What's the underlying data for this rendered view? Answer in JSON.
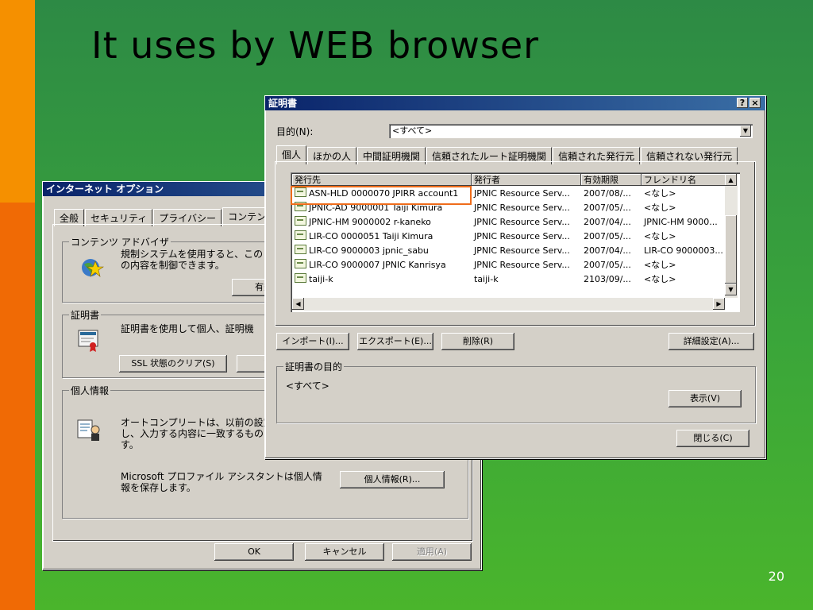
{
  "slide": {
    "title": "It uses by WEB browser",
    "page_number": "20"
  },
  "internet_options": {
    "title": "インターネット オプション",
    "tabs": [
      "全般",
      "セキュリティ",
      "プライバシー",
      "コンテンツ"
    ],
    "content_advisor": {
      "label": "コンテンツ アドバイザ",
      "text1": "規制システムを使用すると、このコ",
      "text2": "の内容を制御できます。",
      "button": "有効"
    },
    "certificates": {
      "label": "証明書",
      "text": "証明書を使用して個人、証明機",
      "ssl_button": "SSL 状態のクリア(S)",
      "cert_button": "証"
    },
    "personal_info": {
      "label": "個人情報",
      "text1": "オートコンプリートは、以前の設定",
      "text2": "し、入力する内容に一致するもの",
      "text3": "す。",
      "ms_text1": "Microsoft プロファイル アシスタントは個人情",
      "ms_text2": "報を保存します。",
      "personal_button": "個人情報(R)..."
    },
    "buttons": {
      "ok": "OK",
      "cancel": "キャンセル",
      "apply": "適用(A)"
    }
  },
  "cert_dialog": {
    "title": "証明書",
    "help_btn": "?",
    "close_btn": "×",
    "purpose_label": "目的(N):",
    "purpose_value": "<すべて>",
    "tabs": [
      "個人",
      "ほかの人",
      "中間証明機関",
      "信頼されたルート証明機関",
      "信頼された発行元",
      "信頼されない発行元"
    ],
    "columns": [
      "発行先",
      "発行者",
      "有効期限",
      "フレンドリ名"
    ],
    "rows": [
      [
        "ASN-HLD 0000070 JPIRR account1",
        "JPNIC Resource Serv...",
        "2007/08/...",
        "<なし>"
      ],
      [
        "JPNIC-AD 9000001 Taiji Kimura",
        "JPNIC Resource Serv...",
        "2007/05/...",
        "<なし>"
      ],
      [
        "JPNIC-HM 9000002 r-kaneko",
        "JPNIC Resource Serv...",
        "2007/04/...",
        "JPNIC-HM 9000..."
      ],
      [
        "LIR-CO 0000051 Taiji Kimura",
        "JPNIC Resource Serv...",
        "2007/05/...",
        "<なし>"
      ],
      [
        "LIR-CO 9000003 jpnic_sabu",
        "JPNIC Resource Serv...",
        "2007/04/...",
        "LIR-CO 9000003..."
      ],
      [
        "LIR-CO 9000007 JPNIC Kanrisya",
        "JPNIC Resource Serv...",
        "2007/05/...",
        "<なし>"
      ],
      [
        "taiji-k",
        "taiji-k",
        "2103/09/...",
        "<なし>"
      ]
    ],
    "buttons": {
      "import": "インポート(I)...",
      "export": "エクスポート(E)...",
      "remove": "削除(R)",
      "advanced": "詳細設定(A)...",
      "view": "表示(V)",
      "close": "閉じる(C)"
    },
    "purposes_label": "証明書の目的",
    "purposes_value": "<すべて>"
  }
}
